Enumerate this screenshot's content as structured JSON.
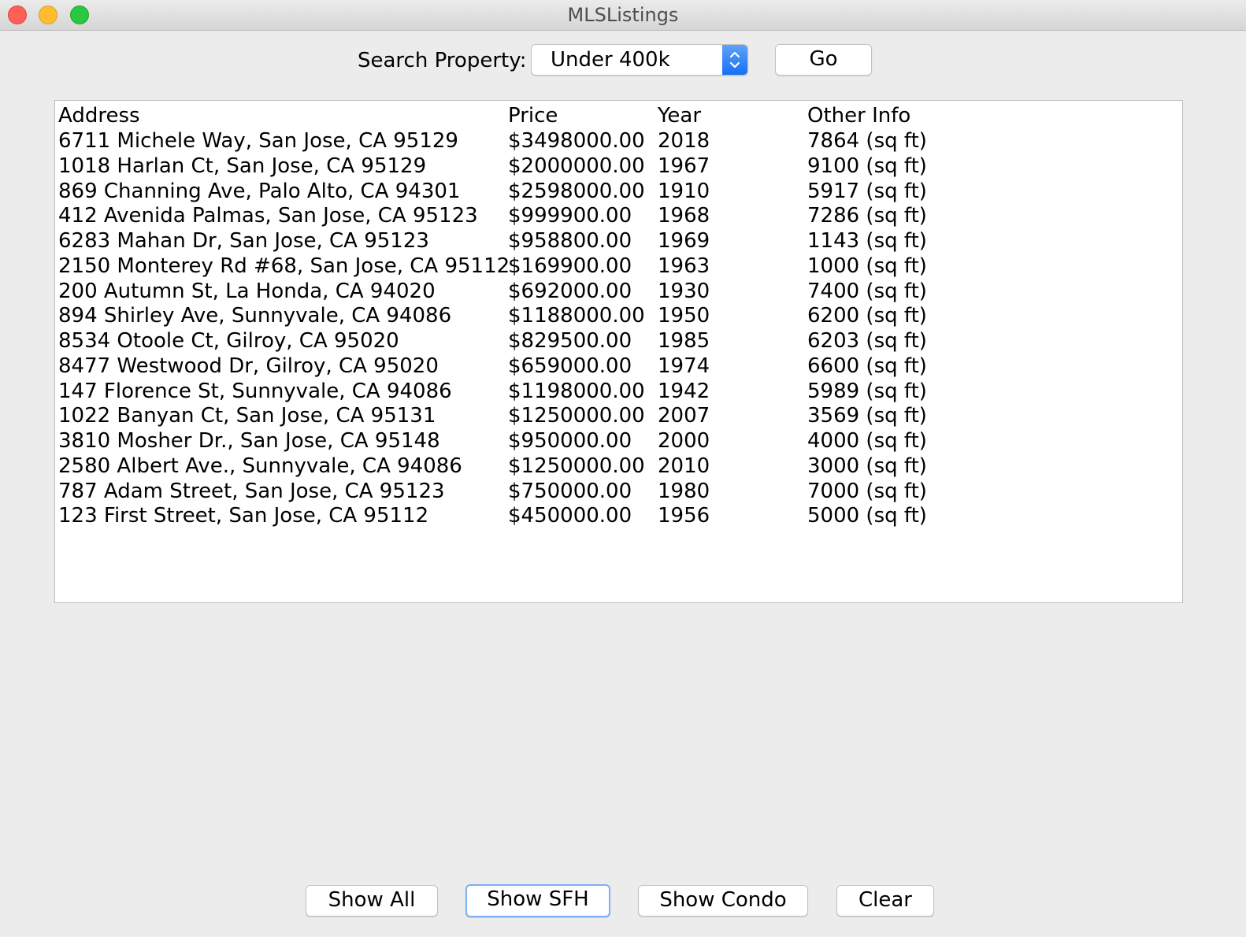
{
  "window": {
    "title": "MLSListings"
  },
  "search": {
    "label": "Search Property:",
    "selected": "Under 400k",
    "go_label": "Go"
  },
  "listing": {
    "headers": {
      "address": "Address",
      "price": "Price",
      "year": "Year",
      "other": "Other Info"
    },
    "rows": [
      {
        "address": "6711 Michele Way, San Jose, CA 95129",
        "price": "$3498000.00",
        "year": "2018",
        "other": "7864 (sq ft)"
      },
      {
        "address": "1018 Harlan Ct, San Jose, CA 95129",
        "price": "$2000000.00",
        "year": "1967",
        "other": "9100 (sq ft)"
      },
      {
        "address": "869 Channing Ave, Palo Alto, CA 94301",
        "price": "$2598000.00",
        "year": "1910",
        "other": "5917 (sq ft)"
      },
      {
        "address": "412 Avenida Palmas, San Jose, CA 95123",
        "price": "$999900.00",
        "year": "1968",
        "other": "7286 (sq ft)"
      },
      {
        "address": "6283 Mahan Dr, San Jose, CA 95123",
        "price": "$958800.00",
        "year": "1969",
        "other": "1143 (sq ft)"
      },
      {
        "address": "2150 Monterey Rd #68, San Jose, CA 95112",
        "price": "$169900.00",
        "year": "1963",
        "other": "1000 (sq ft)"
      },
      {
        "address": "200 Autumn St, La Honda, CA 94020",
        "price": "$692000.00",
        "year": "1930",
        "other": "7400 (sq ft)"
      },
      {
        "address": "894 Shirley Ave, Sunnyvale, CA 94086",
        "price": "$1188000.00",
        "year": "1950",
        "other": "6200 (sq ft)"
      },
      {
        "address": "8534 Otoole Ct, Gilroy, CA 95020",
        "price": "$829500.00",
        "year": "1985",
        "other": "6203 (sq ft)"
      },
      {
        "address": "8477 Westwood Dr, Gilroy, CA 95020",
        "price": "$659000.00",
        "year": "1974",
        "other": "6600 (sq ft)"
      },
      {
        "address": "147 Florence St, Sunnyvale, CA 94086",
        "price": "$1198000.00",
        "year": "1942",
        "other": "5989 (sq ft)"
      },
      {
        "address": "1022 Banyan Ct, San Jose, CA 95131",
        "price": "$1250000.00",
        "year": "2007",
        "other": "3569 (sq ft)"
      },
      {
        "address": "3810 Mosher Dr., San Jose, CA 95148",
        "price": "$950000.00",
        "year": "2000",
        "other": "4000 (sq ft)"
      },
      {
        "address": "2580 Albert Ave., Sunnyvale, CA 94086",
        "price": "$1250000.00",
        "year": "2010",
        "other": "3000 (sq ft)"
      },
      {
        "address": "787 Adam Street, San Jose, CA 95123",
        "price": "$750000.00",
        "year": "1980",
        "other": "7000 (sq ft)"
      },
      {
        "address": "123 First Street, San Jose, CA 95112",
        "price": "$450000.00",
        "year": "1956",
        "other": "5000 (sq ft)"
      }
    ]
  },
  "buttons": {
    "show_all": "Show All",
    "show_sfh": "Show SFH",
    "show_condo": "Show Condo",
    "clear": "Clear"
  },
  "colors": {
    "close": "#fe5f57",
    "minimize": "#febc2e",
    "zoom": "#28c840",
    "accent": "#1671f3",
    "focus_ring": "#7eaef4"
  },
  "icons": {
    "combo_arrows": "up-down-chevron-icon"
  }
}
